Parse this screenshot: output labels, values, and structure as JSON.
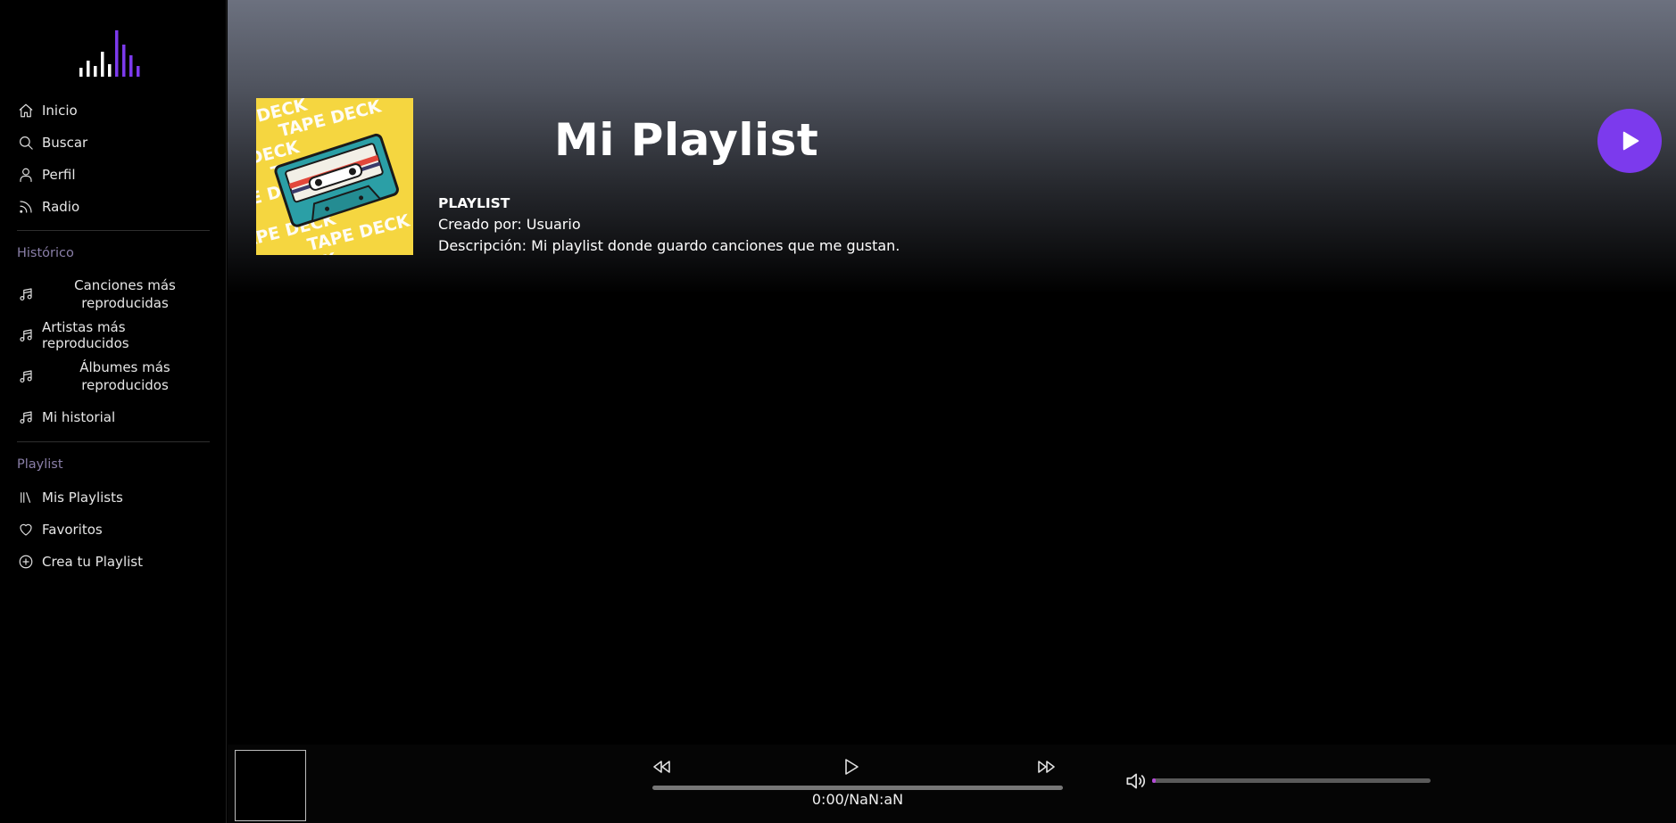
{
  "sidebar": {
    "main_nav": [
      {
        "label": "Inicio",
        "icon": "home-icon"
      },
      {
        "label": "Buscar",
        "icon": "search-icon"
      },
      {
        "label": "Perfil",
        "icon": "user-icon"
      },
      {
        "label": "Radio",
        "icon": "rss-icon"
      }
    ],
    "historico": {
      "heading": "Histórico",
      "items": [
        {
          "label": "Canciones más reproducidas",
          "icon": "music-note-icon"
        },
        {
          "label": "Artistas más reproducidos",
          "icon": "music-note-icon"
        },
        {
          "label": "Álbumes más reproducidos",
          "icon": "music-note-icon"
        },
        {
          "label": "Mi historial",
          "icon": "music-note-icon"
        }
      ]
    },
    "playlist": {
      "heading": "Playlist",
      "items": [
        {
          "label": "Mis Playlists",
          "icon": "library-icon"
        },
        {
          "label": "Favoritos",
          "icon": "heart-icon"
        },
        {
          "label": "Crea tu Playlist",
          "icon": "plus-circle-icon"
        }
      ]
    }
  },
  "playlist": {
    "title": "Mi Playlist",
    "kind": "PLAYLIST",
    "created_by": "Creado por: Usuario",
    "description": "Descripción: Mi playlist donde guardo canciones que me gustan.",
    "cover_text": "TAPE DECK"
  },
  "player": {
    "time": "0:00/NaN:aN",
    "progress": 0,
    "volume": 0.01
  },
  "colors": {
    "accent": "#7c3aed",
    "volume_fill": "#b449d8",
    "section_label": "#8a7fa8"
  }
}
